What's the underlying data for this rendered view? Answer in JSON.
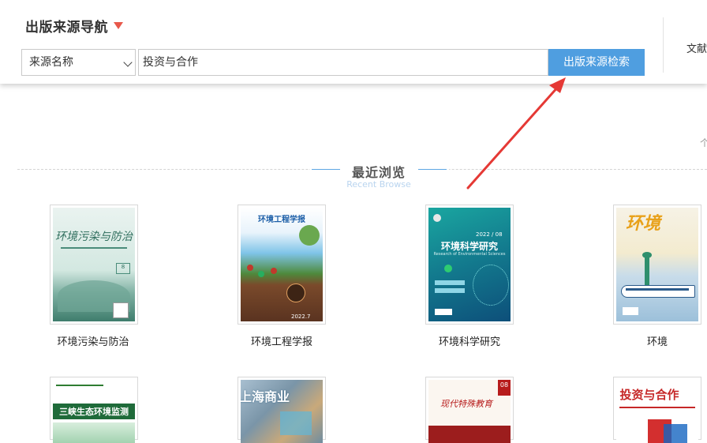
{
  "header": {
    "nav_title": "出版来源导航",
    "select_value": "来源名称",
    "search_value": "投资与合作",
    "search_button": "出版来源检索",
    "doc_link": "文献",
    "edge_char": "个"
  },
  "section": {
    "title": "最近浏览",
    "subtitle": "Recent Browse"
  },
  "books": [
    {
      "title": "环境污染与防治",
      "cover_text": "环境污染与防治"
    },
    {
      "title": "环境工程学报",
      "cover_text": "环境工程学报",
      "cover_date": "2022.7"
    },
    {
      "title": "环境科学研究",
      "cover_text": "环境科学研究",
      "cover_date": "2022 / 08",
      "cover_en": "Research of Environmental Sciences"
    },
    {
      "title": "环境",
      "cover_text": "环境"
    },
    {
      "title": "",
      "cover_text": "三峡生态环境监测"
    },
    {
      "title": "",
      "cover_text": "上海商业"
    },
    {
      "title": "",
      "cover_text": "现代特殊教育",
      "cover_badge": "08"
    },
    {
      "title": "",
      "cover_text": "投资与合作"
    }
  ],
  "colors": {
    "accent_blue": "#4f9ee0",
    "caret_red": "#e8584b",
    "arrow_red": "#e53935"
  }
}
